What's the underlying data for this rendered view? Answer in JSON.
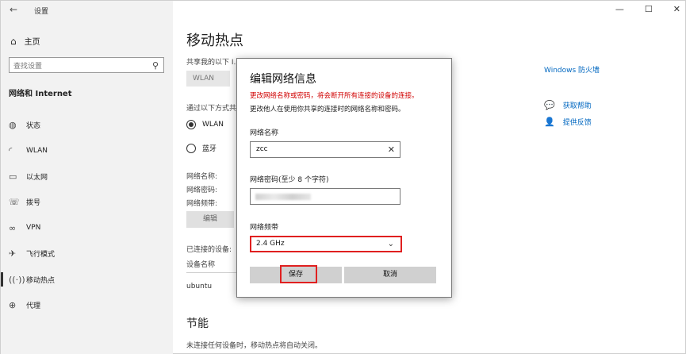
{
  "window": {
    "title": "设置"
  },
  "sidebar": {
    "home": "主页",
    "search_placeholder": "查找设置",
    "section": "网络和 Internet",
    "items": [
      {
        "label": "状态",
        "icon": "status-icon"
      },
      {
        "label": "WLAN",
        "icon": "wifi-icon"
      },
      {
        "label": "以太网",
        "icon": "ethernet-icon"
      },
      {
        "label": "拨号",
        "icon": "dialup-icon"
      },
      {
        "label": "VPN",
        "icon": "vpn-icon"
      },
      {
        "label": "飞行模式",
        "icon": "airplane-icon"
      },
      {
        "label": "移动热点",
        "icon": "hotspot-icon",
        "active": true
      },
      {
        "label": "代理",
        "icon": "globe-icon"
      }
    ]
  },
  "main": {
    "title": "移动热点",
    "share_label": "共享我的以下 I...",
    "share_value": "WLAN",
    "via_label": "通过以下方式共...",
    "radio_wlan": "WLAN",
    "radio_bt": "蓝牙",
    "info_name": "网络名称:",
    "info_password": "网络密码:",
    "info_band": "网络频带:",
    "edit_button": "编辑",
    "connected_label": "已连接的设备:",
    "device_col": "设备名称",
    "device_1": "ubuntu",
    "energy_title": "节能",
    "energy_desc": "未连接任何设备时，移动热点将自动关闭。",
    "link_firewall": "Windows 防火墙",
    "link_help": "获取帮助",
    "link_feedback": "提供反馈"
  },
  "dialog": {
    "title": "编辑网络信息",
    "warning": "更改网络名称或密码，将会断开所有连接的设备的连接。",
    "note": "更改他人在使用你共享的连接时的网络名称和密码。",
    "name_label": "网络名称",
    "name_value": "zcc",
    "password_label": "网络密码(至少 8 个字符)",
    "band_label": "网络频带",
    "band_value": "2.4 GHz",
    "save": "保存",
    "cancel": "取消"
  }
}
